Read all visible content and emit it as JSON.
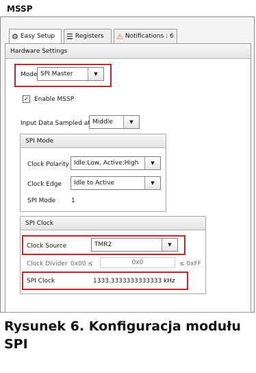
{
  "window": {
    "title": "MSSP"
  },
  "tabs": [
    {
      "label": "Easy Setup",
      "icon": "gear-icon"
    },
    {
      "label": "Registers",
      "icon": "registers-icon"
    },
    {
      "label": "Notifications : 6",
      "icon": "warning-icon"
    }
  ],
  "hardware_settings": {
    "header": "Hardware Settings",
    "mode_label": "Mode",
    "mode_value": "SPI Master",
    "enable_label": "Enable MSSP",
    "enable_checked": true,
    "input_sampled_label": "Input Data Sampled at",
    "input_sampled_value": "Middle"
  },
  "spi_mode": {
    "header": "SPI Mode",
    "clock_polarity_label": "Clock Polarity",
    "clock_polarity_value": "Idle:Low, Active:High",
    "clock_edge_label": "Clock Edge",
    "clock_edge_value": "Idle to Active",
    "spi_mode_label": "SPI Mode",
    "spi_mode_value": "1"
  },
  "spi_clock": {
    "header": "SPI Clock",
    "clock_source_label": "Clock Source",
    "clock_source_value": "TMR2",
    "clock_divider_label": "Clock Divider",
    "clock_divider_min": "0x00 ≤",
    "clock_divider_value": "0x0",
    "clock_divider_max": "≤ 0xFF",
    "spi_clock_label": "SPI Clock",
    "spi_clock_value": "1333.3333333333333 kHz"
  },
  "caption": "Rysunek 6. Konfiguracja modułu SPI",
  "colors": {
    "highlight": "#d0202a",
    "panel_bg": "#f4f4f4"
  }
}
